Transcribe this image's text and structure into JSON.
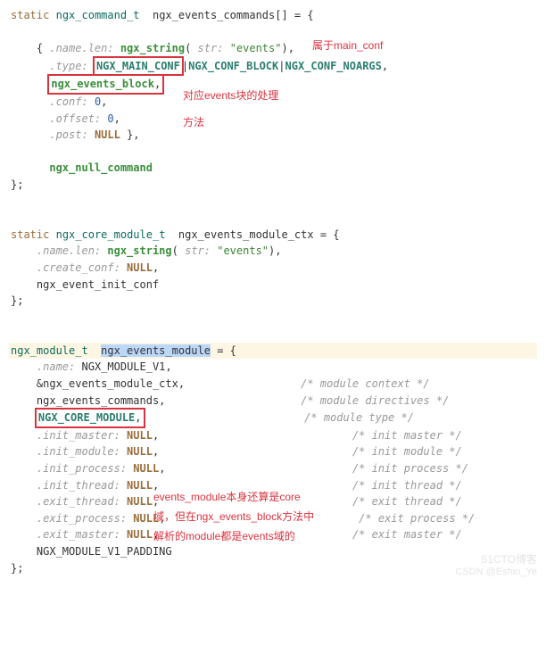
{
  "block1": {
    "l1_static": "static",
    "l1_type": "ngx_command_t",
    "l1_var": "ngx_events_commands[] = {",
    "l2_brace": "    { ",
    "l2_param": ".name.len:",
    "l2_func": " ngx_string",
    "l2_paren_open": "( ",
    "l2_strhint": "str:",
    "l2_space": " ",
    "l2_string": "\"events\"",
    "l2_paren_close": "),",
    "l3_indent": "      ",
    "l3_param": ".type:",
    "l3_space": " ",
    "l3_macro1": "NGX_MAIN_CONF",
    "l3_pipe1": "|",
    "l3_macro2": "NGX_CONF_BLOCK",
    "l3_pipe2": "|",
    "l3_macro3": "NGX_CONF_NOARGS",
    "l3_comma": ",",
    "l4_indent": "      ",
    "l4_func": "ngx_events_block",
    "l4_comma": ",",
    "l5_indent": "      ",
    "l5_param": ".conf:",
    "l5_val": " 0",
    "l5_comma": ",",
    "l6_indent": "      ",
    "l6_param": ".offset:",
    "l6_val": " 0",
    "l6_comma": ",",
    "l7_indent": "      ",
    "l7_param": ".post:",
    "l7_val": " NULL",
    "l7_close": " },",
    "l8": "      ngx_null_command",
    "l9": "};"
  },
  "block2": {
    "l1_static": "static",
    "l1_type": "ngx_core_module_t",
    "l1_var": "  ngx_events_module_ctx = {",
    "l2_indent": "    ",
    "l2_param": ".name.len:",
    "l2_func": " ngx_string",
    "l2_paren_open": "( ",
    "l2_strhint": "str:",
    "l2_space": " ",
    "l2_string": "\"events\"",
    "l2_paren_close": "),",
    "l3_indent": "    ",
    "l3_param": ".create_conf:",
    "l3_val": " NULL",
    "l3_comma": ",",
    "l4": "    ngx_event_init_conf",
    "l5": "};"
  },
  "block3": {
    "l1_type": "ngx_module_t",
    "l1_gap": "  ",
    "l1_sel": "ngx_events_module",
    "l1_rest": " = {",
    "l2_indent": "    ",
    "l2_param": ".name:",
    "l2_val": " NGX_MODULE_V1,",
    "l3_indent": "    ",
    "l3_val": "&ngx_events_module_ctx,",
    "l3_comment": "/* module context */",
    "l4_indent": "    ",
    "l4_val": "ngx_events_commands,",
    "l4_comment": "/* module directives */",
    "l5_indent": "    ",
    "l5_macro": "NGX_CORE_MODULE",
    "l5_comma": ",",
    "l5_comment": "/* module type */",
    "l6_indent": "    ",
    "l6_param": ".init_master:",
    "l6_val": " NULL",
    "l6_comma": ",",
    "l6_comment": "/* init master */",
    "l7_indent": "    ",
    "l7_param": ".init_module:",
    "l7_val": " NULL",
    "l7_comma": ",",
    "l7_comment": "/* init module */",
    "l8_indent": "    ",
    "l8_param": ".init_process:",
    "l8_val": " NULL",
    "l8_comma": ",",
    "l8_comment": "/* init process */",
    "l9_indent": "    ",
    "l9_param": ".init_thread:",
    "l9_val": " NULL",
    "l9_comma": ",",
    "l9_comment": "/* init thread */",
    "l10_indent": "    ",
    "l10_param": ".exit_thread:",
    "l10_val": " NULL",
    "l10_comma": ",",
    "l10_comment": "/* exit thread */",
    "l11_indent": "    ",
    "l11_param": ".exit_process:",
    "l11_val": " NULL",
    "l11_comma": ",",
    "l11_comment": "/* exit process */",
    "l12_indent": "    ",
    "l12_param": ".exit_master:",
    "l12_val": " NULL",
    "l12_comma": ",",
    "l12_comment": "/* exit master */",
    "l13": "    NGX_MODULE_V1_PADDING",
    "l14": "};"
  },
  "annotations": {
    "a1": "属于main_conf",
    "a2": "对应events块的处理",
    "a3": "方法",
    "a4": "events_module本身还算是core",
    "a5": "域，但在ngx_events_block方法中",
    "a6": "解析的module都是events域的"
  },
  "watermarks": {
    "w1": "51CTO博客",
    "w2": "CSDN @Eshin_Ye"
  }
}
